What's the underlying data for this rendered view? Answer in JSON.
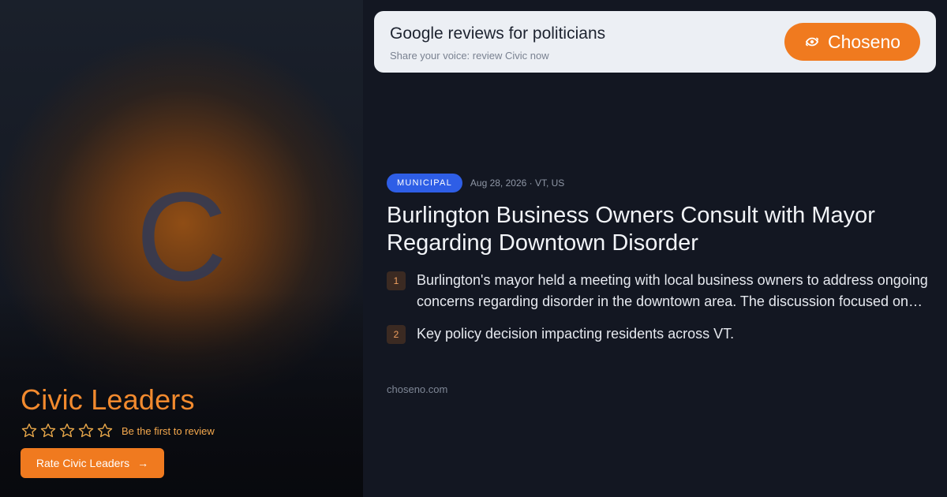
{
  "profile": {
    "monogram": "C",
    "name": "Civic Leaders",
    "rating_text": "Be the first to review",
    "stars": 0,
    "rate_button_label": "Rate Civic Leaders"
  },
  "banner": {
    "title": "Google reviews for politicians",
    "subtitle": "Share your voice: review Civic now",
    "brand_label": "Choseno",
    "brand_icon": "eye-refresh-icon"
  },
  "article": {
    "category": "MUNICIPAL",
    "meta": "Aug 28, 2026 · VT, US",
    "headline": "Burlington Business Owners Consult with Mayor Regarding Downtown Disorder",
    "points": [
      {
        "number": "1",
        "text": "Burlington's mayor held a meeting with local business owners to address ongoing concerns regarding disorder in the downtown area. The discussion focused on…"
      },
      {
        "number": "2",
        "text": "Key policy decision impacting residents across VT."
      }
    ],
    "source": "choseno.com"
  },
  "colors": {
    "accent": "#f07a1f",
    "badge": "#2e5ee6",
    "background": "#131722",
    "banner": "#eceff4"
  }
}
